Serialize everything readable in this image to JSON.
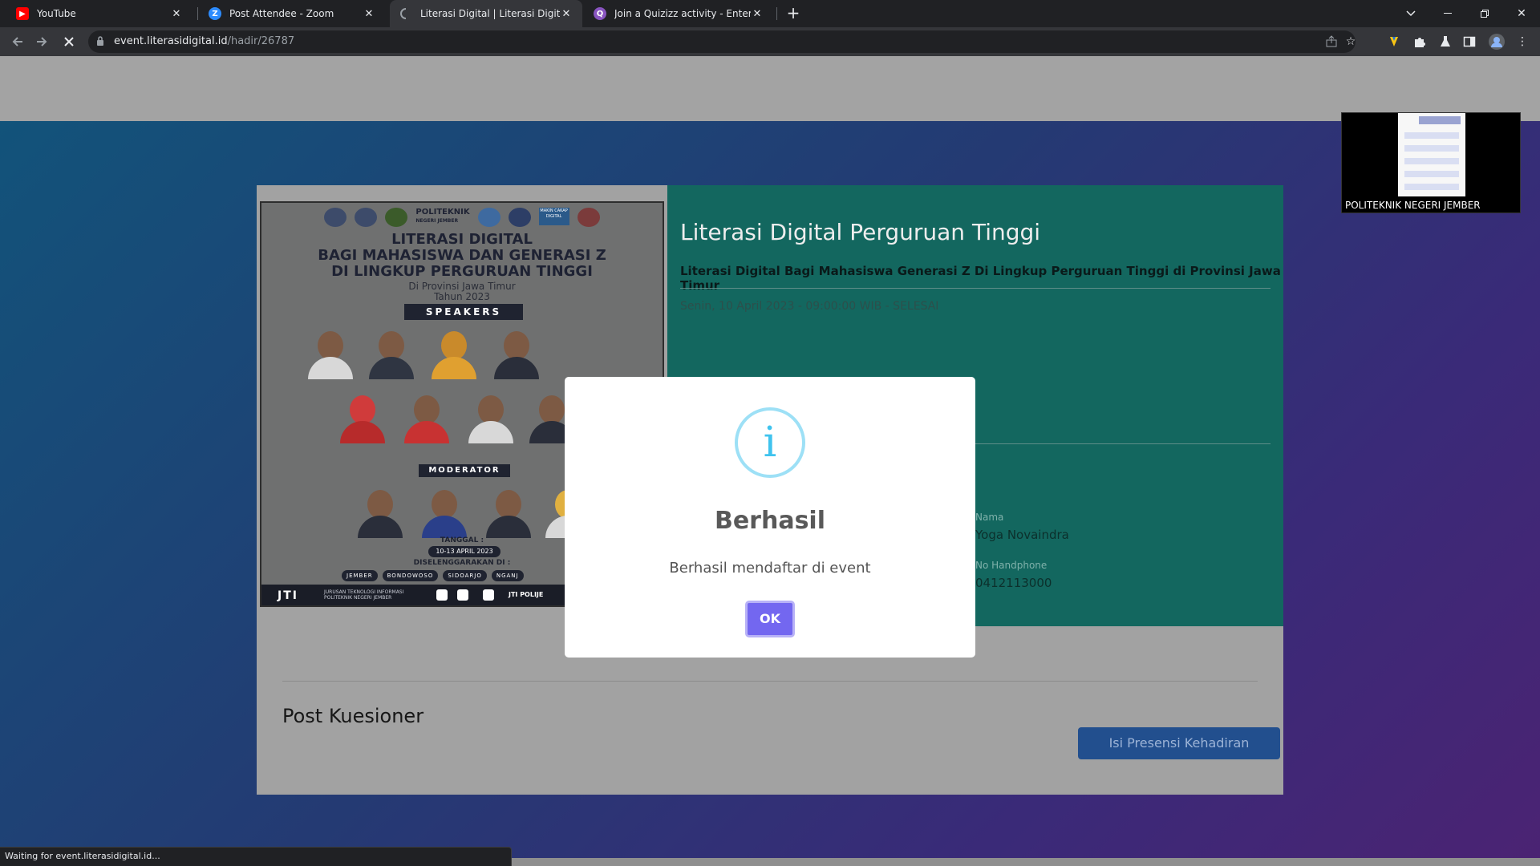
{
  "browser": {
    "tabs": [
      {
        "title": "YouTube",
        "favicon_color": "#ff0000",
        "favicon": "youtube-icon",
        "active": false
      },
      {
        "title": "Post Attendee - Zoom",
        "favicon_color": "#2d8cff",
        "favicon": "zoom-icon",
        "active": false
      },
      {
        "title": "Literasi Digital | Literasi Digital Pe",
        "favicon_color": "#9aa0a6",
        "favicon": "loading-spinner-icon",
        "active": true
      },
      {
        "title": "Join a Quizizz activity - Enter cod",
        "favicon_color": "#8854c0",
        "favicon": "quizizz-icon",
        "active": false
      }
    ],
    "url_domain": "event.literasidigital.id",
    "url_path": "/hadir/26787",
    "status_text": "Waiting for event.literasidigital.id..."
  },
  "event": {
    "title": "Literasi Digital Perguruan Tinggi",
    "subtitle": "Literasi Digital Bagi Mahasiswa Generasi Z Di Lingkup Perguruan Tinggi di Provinsi Jawa Timur",
    "date": "Senin, 10 April 2023 - 09:00:00 WIB - SELESAI",
    "fields": {
      "nama_label": "Nama",
      "nama_value": "Yoga Novaindra",
      "hp_label": "No Handphone",
      "hp_value": "0412113000"
    }
  },
  "poster": {
    "institution": "POLITEKNIK",
    "institution_sub": "NEGERI JEMBER",
    "badge": "MAKIN CAKAP DIGITAL",
    "title_line1": "LITERASI DIGITAL",
    "title_line2": "BAGI MAHASISWA DAN GENERASI Z",
    "title_line3": "DI LINGKUP PERGURUAN TINGGI",
    "sub_line1": "Di Provinsi Jawa Timur",
    "sub_line2": "Tahun 2023",
    "speakers_label": "SPEAKERS",
    "moderator_label": "MODERATOR",
    "tanggal_label": "TANGGAL :",
    "tanggal_value": "10-13 APRIL 2023",
    "diselenggarakan_label": "DISELENGGARAKAN DI :",
    "cities": [
      "JEMBER",
      "BONDOWOSO",
      "SIDOARJO",
      "NGANJ"
    ],
    "footer_logo": "JTI",
    "footer_sub1": "JURUSAN TEKNOLOGI INFORMASI",
    "footer_sub2": "POLITEKNIK NEGERI JEMBER",
    "footer_handle": "JTI POLIJE"
  },
  "section": {
    "post_kuesioner": "Post Kuesioner",
    "presensi_button": "Isi Presensi Kehadiran"
  },
  "modal": {
    "icon": "info-icon",
    "icon_glyph": "i",
    "title": "Berhasil",
    "text": "Berhasil mendaftar di event",
    "ok_label": "OK"
  },
  "zoom": {
    "participant_name": "POLITEKNIK NEGERI JEMBER"
  },
  "colors": {
    "info_panel": "#13675f",
    "modal_button": "#7367f0",
    "info_icon": "#3fc3ee",
    "presensi_button": "#224f8e"
  }
}
